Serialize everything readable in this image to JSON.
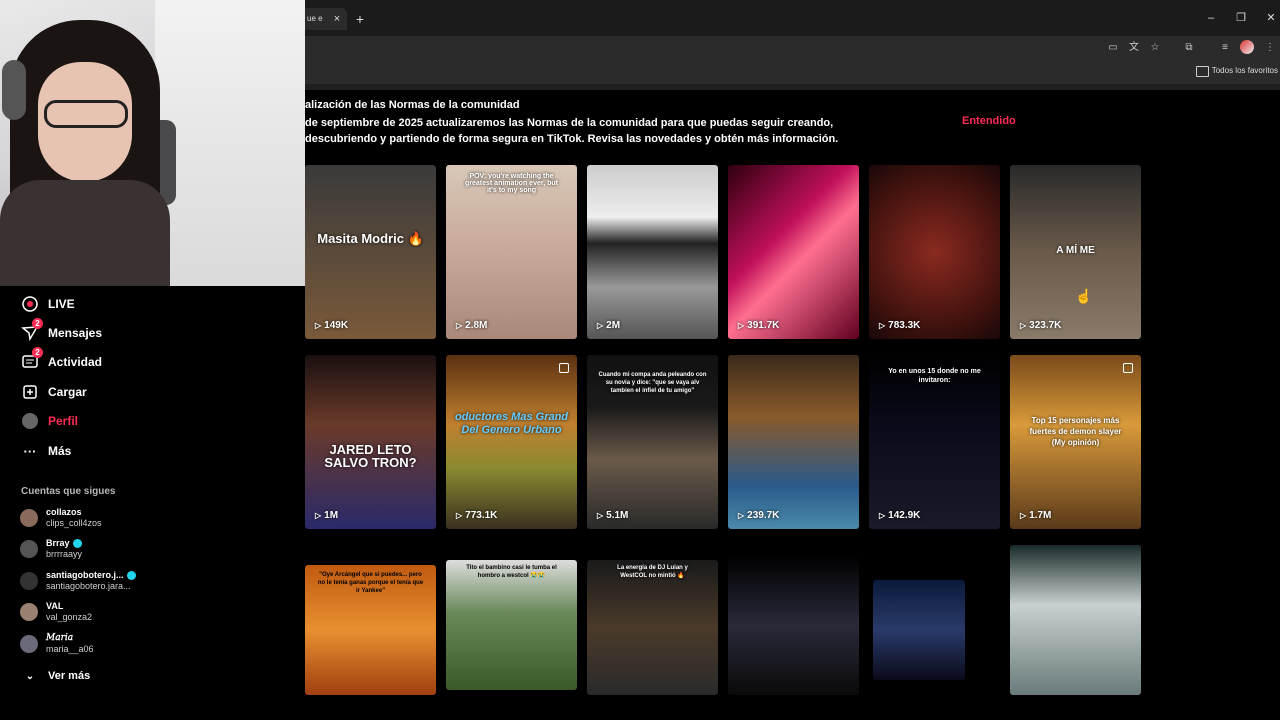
{
  "browser": {
    "tab_title": "ue e",
    "tab_close": "×",
    "new_tab": "+",
    "window": {
      "minimize": "–",
      "restore": "❐",
      "close": "✕"
    },
    "bookmarks_label": "Todos los favoritos"
  },
  "sidebar": {
    "nav": [
      {
        "label": "LIVE",
        "icon": "live-icon"
      },
      {
        "label": "Mensajes",
        "icon": "messages-icon",
        "badge": "2"
      },
      {
        "label": "Actividad",
        "icon": "activity-icon",
        "badge": "2"
      },
      {
        "label": "Cargar",
        "icon": "upload-icon"
      },
      {
        "label": "Perfil",
        "icon": "profile-icon",
        "active": true
      },
      {
        "label": "Más",
        "icon": "more-icon"
      }
    ],
    "following_title": "Cuentas que sigues",
    "following": [
      {
        "display": "collazos",
        "handle": "clips_coll4zos",
        "verified": false
      },
      {
        "display": "Brray",
        "handle": "brrrraayy",
        "verified": true
      },
      {
        "display": "santiagobotero.j...",
        "handle": "santiagobotero.jara...",
        "verified": true
      },
      {
        "display": "VAL",
        "handle": "val_gonza2",
        "verified": false
      },
      {
        "display": "𝑀𝑎𝑟𝑖𝑎",
        "handle": "maria__a06",
        "verified": false
      }
    ],
    "see_more": "Ver más"
  },
  "notice": {
    "title": "alización de las Normas de la comunidad",
    "body": "de septiembre de 2025 actualizaremos las Normas de la comunidad para que puedas seguir creando, descubriendo y partiendo de forma segura en TikTok. Revisa las novedades y obtén más información.",
    "action": "Entendido"
  },
  "videos": [
    {
      "views": "149K",
      "overlay": "Masita Modric 🔥"
    },
    {
      "views": "2.8M",
      "overlay": "POV: you're watching the greatest animation ever, but it's to my song"
    },
    {
      "views": "2M",
      "overlay": ""
    },
    {
      "views": "391.7K",
      "overlay": ""
    },
    {
      "views": "783.3K",
      "overlay": ""
    },
    {
      "views": "323.7K",
      "overlay": "A MÍ ME"
    },
    {
      "views": "1M",
      "overlay": "JARED LETO SALVO TRON?"
    },
    {
      "views": "773.1K",
      "overlay": "oductores Mas Grand Del Genero Urbano"
    },
    {
      "views": "5.1M",
      "overlay": "Cuando mi compa anda peleando con su novia y dice: \"que se vaya alv tambien el infiel de tu amigo\""
    },
    {
      "views": "239.7K",
      "overlay": ""
    },
    {
      "views": "142.9K",
      "overlay": "Yo en unos 15 donde no me invitaron:"
    },
    {
      "views": "1.7M",
      "overlay": "Top 15 personajes más fuertes de demon slayer (My opinión)"
    },
    {
      "views": "",
      "overlay": "\"Oye Arcángel que si puedes... pero no le tenía ganas porque el tenía que ir Yankee\""
    },
    {
      "views": "",
      "overlay": "Tito el bambino casi le tumba el hombro a westcol 😭😭"
    },
    {
      "views": "",
      "overlay": "La energía de DJ Luian y WestCOL no mintió 🔥"
    },
    {
      "views": "",
      "overlay": ""
    },
    {
      "views": "",
      "overlay": ""
    },
    {
      "views": "",
      "overlay": ""
    }
  ]
}
